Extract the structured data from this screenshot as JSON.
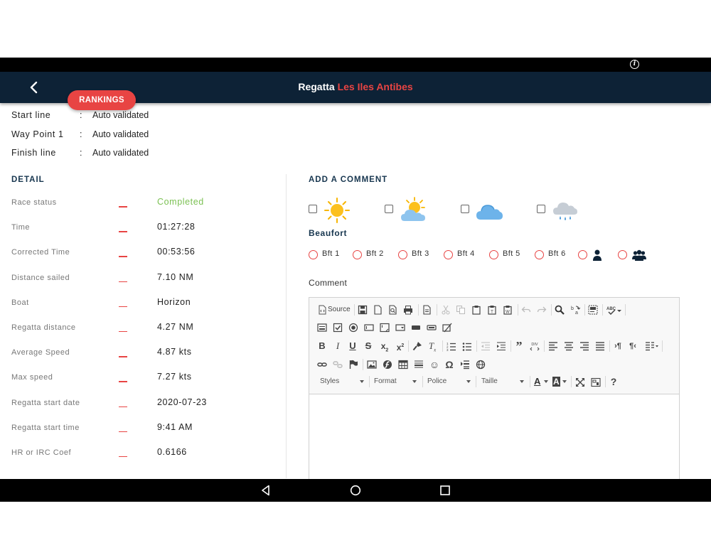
{
  "header": {
    "title_prefix": "Regatta",
    "title_accent": "Les Iles Antibes",
    "rankings_label": "RANKINGS"
  },
  "checkpoints": [
    {
      "name": "Start line",
      "separator": ":",
      "value": "Auto validated"
    },
    {
      "name": "Way Point 1",
      "separator": ":",
      "value": "Auto validated"
    },
    {
      "name": "Finish line",
      "separator": ":",
      "value": "Auto validated"
    }
  ],
  "detail": {
    "title": "DETAIL",
    "rows": [
      {
        "label": "Race status",
        "value": "Completed"
      },
      {
        "label": "Time",
        "value": "01:27:28"
      },
      {
        "label": "Corrected Time",
        "value": "00:53:56"
      },
      {
        "label": "Distance sailed",
        "value": "7.10 NM"
      },
      {
        "label": "Boat",
        "value": "Horizon"
      },
      {
        "label": "Regatta distance",
        "value": "4.27 NM"
      },
      {
        "label": "Average Speed",
        "value": "4.87 kts"
      },
      {
        "label": "Max speed",
        "value": "7.27 kts"
      },
      {
        "label": "Regatta start date",
        "value": "2020-07-23"
      },
      {
        "label": "Regatta start time",
        "value": "9:41 AM"
      },
      {
        "label": "HR or IRC Coef",
        "value": "0.6166"
      }
    ]
  },
  "comment": {
    "title": "ADD A COMMENT",
    "weather_options": [
      "sunny-icon",
      "partly-cloudy-icon",
      "cloudy-icon",
      "rainy-icon"
    ],
    "beaufort_title": "Beaufort",
    "beaufort_options": [
      "Bft 1",
      "Bft 2",
      "Bft 3",
      "Bft 4",
      "Bft 5",
      "Bft 6"
    ],
    "crew_options": [
      "solo-person-icon",
      "crew-group-icon"
    ],
    "comment_label": "Comment"
  },
  "editor": {
    "source_label": "Source",
    "styles_label": "Styles",
    "format_label": "Format",
    "police_label": "Police",
    "taille_label": "Taille"
  },
  "colors": {
    "header_bg": "#0d2236",
    "accent": "#e84443",
    "completed": "#7cc154",
    "section_title": "#17364f"
  }
}
